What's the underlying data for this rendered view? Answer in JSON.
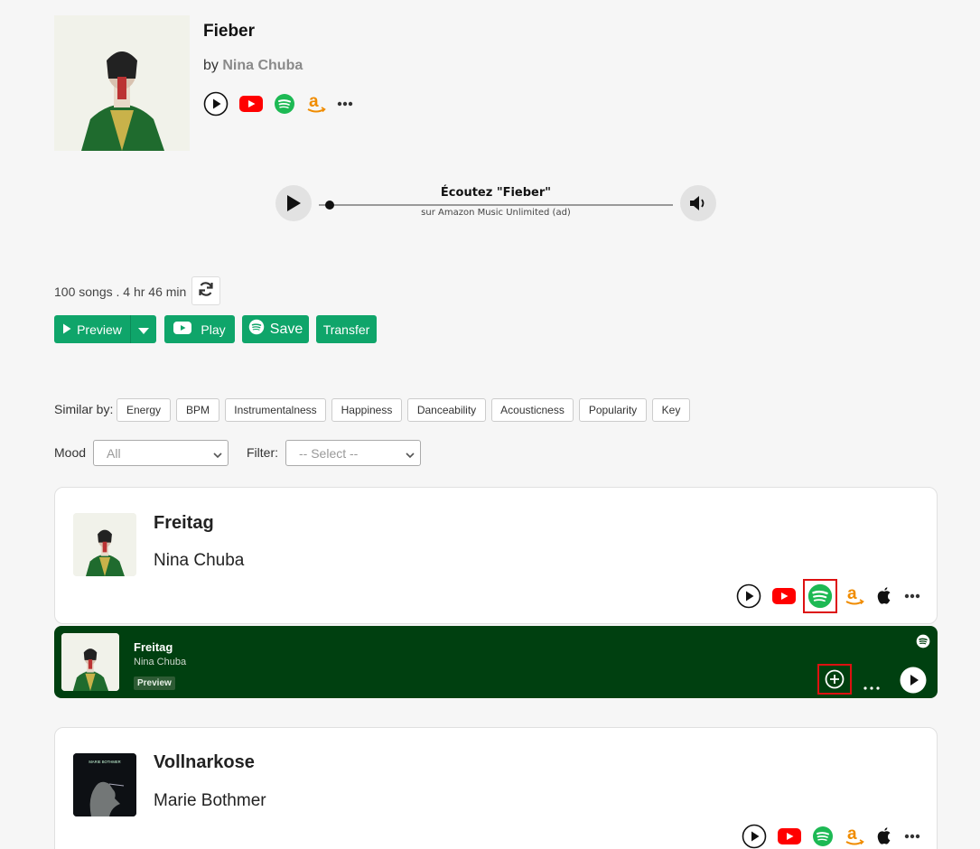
{
  "header": {
    "title": "Fieber",
    "by_prefix": "by",
    "artist": "Nina Chuba",
    "icons": [
      "play-circle-icon",
      "youtube-icon",
      "spotify-icon",
      "amazon-icon",
      "more-icon"
    ]
  },
  "player": {
    "title": "Écoutez \"Fieber\"",
    "subtitle": "sur Amazon Music Unlimited (ad)"
  },
  "playlist": {
    "stats": "100 songs . 4 hr 46 min",
    "buttons": {
      "preview": "Preview",
      "play": "Play",
      "save": "Save",
      "transfer": "Transfer"
    }
  },
  "similar": {
    "label": "Similar by:",
    "chips": [
      "Energy",
      "BPM",
      "Instrumentalness",
      "Happiness",
      "Danceability",
      "Acousticness",
      "Popularity",
      "Key"
    ]
  },
  "filters": {
    "mood_label": "Mood",
    "mood_value": "All",
    "filter_label": "Filter:",
    "filter_value": "-- Select --"
  },
  "songs": [
    {
      "title": "Freitag",
      "artist": "Nina Chuba"
    },
    {
      "title": "Vollnarkose",
      "artist": "Marie Bothmer",
      "cover_text": "MARIE BOTHMER"
    }
  ],
  "embed": {
    "title": "Freitag",
    "artist": "Nina Chuba",
    "badge": "Preview"
  },
  "colors": {
    "green_button": "#0fa56a",
    "embed_bg": "#004010",
    "spotify": "#1db954",
    "youtube": "#ff0000",
    "amazon": "#f08c00",
    "highlight": "#d11111"
  }
}
